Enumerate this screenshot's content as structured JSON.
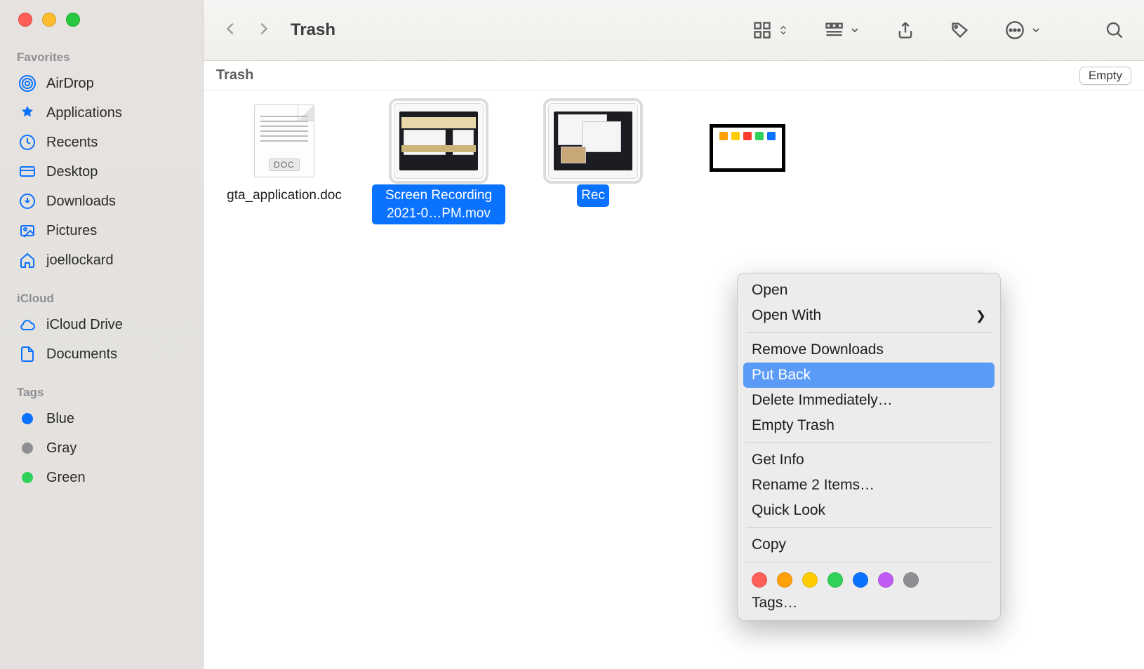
{
  "window": {
    "title": "Trash"
  },
  "sidebar": {
    "sections": [
      {
        "header": "Favorites",
        "items": [
          {
            "label": "AirDrop"
          },
          {
            "label": "Applications"
          },
          {
            "label": "Recents"
          },
          {
            "label": "Desktop"
          },
          {
            "label": "Downloads"
          },
          {
            "label": "Pictures"
          },
          {
            "label": "joellockard"
          }
        ]
      },
      {
        "header": "iCloud",
        "items": [
          {
            "label": "iCloud Drive"
          },
          {
            "label": "Documents"
          }
        ]
      },
      {
        "header": "Tags",
        "items": [
          {
            "label": "Blue"
          },
          {
            "label": "Gray"
          },
          {
            "label": "Green"
          }
        ]
      }
    ]
  },
  "locationBar": {
    "path": "Trash",
    "emptyLabel": "Empty"
  },
  "files": [
    {
      "name": "gta_application.doc",
      "selected": false,
      "kind": "doc"
    },
    {
      "name": "Screen Recording 2021-0…PM.mov",
      "selected": true,
      "kind": "video"
    },
    {
      "name": "Rec",
      "selected": true,
      "kind": "video"
    },
    {
      "name": "",
      "selected": false,
      "kind": "screenshot"
    }
  ],
  "contextMenu": {
    "items": [
      {
        "label": "Open",
        "type": "item"
      },
      {
        "label": "Open With",
        "type": "submenu"
      },
      {
        "type": "sep"
      },
      {
        "label": "Remove Downloads",
        "type": "item"
      },
      {
        "label": "Put Back",
        "type": "item",
        "highlight": true
      },
      {
        "label": "Delete Immediately…",
        "type": "item"
      },
      {
        "label": "Empty Trash",
        "type": "item"
      },
      {
        "type": "sep"
      },
      {
        "label": "Get Info",
        "type": "item"
      },
      {
        "label": "Rename 2 Items…",
        "type": "item"
      },
      {
        "label": "Quick Look",
        "type": "item"
      },
      {
        "type": "sep"
      },
      {
        "label": "Copy",
        "type": "item"
      },
      {
        "type": "sep"
      },
      {
        "type": "colors",
        "colors": [
          "#ff5f57",
          "#ff9f0a",
          "#ffcc00",
          "#30d158",
          "#0a72ff",
          "#bf5af2",
          "#8e8e93"
        ]
      },
      {
        "label": "Tags…",
        "type": "item"
      }
    ]
  }
}
